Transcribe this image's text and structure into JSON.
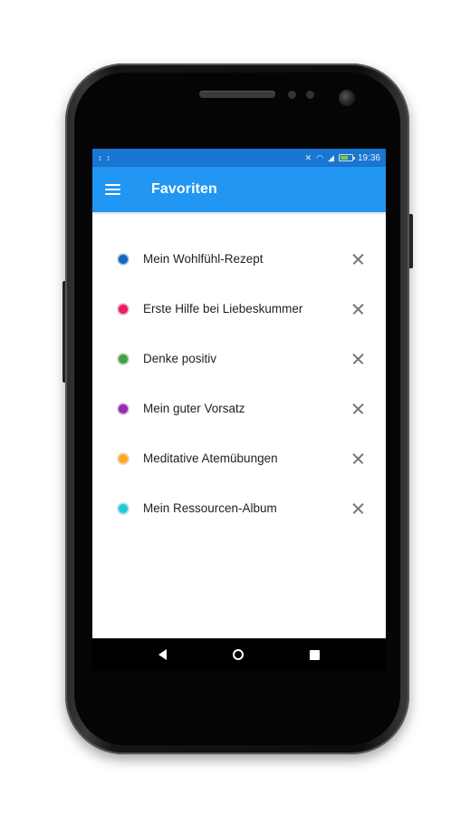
{
  "status_bar": {
    "left_icons": [
      "↕",
      "↕"
    ],
    "right_icons": [
      "mute-icon",
      "wifi-icon",
      "signal-icon",
      "battery-icon"
    ],
    "time": "19:36",
    "color": "#1976d2"
  },
  "app_bar": {
    "title": "Favoriten",
    "menu_icon": "hamburger-menu-icon",
    "color": "#2196f3"
  },
  "favorites": [
    {
      "label": "Mein Wohlfühl-Rezept",
      "color": "#1565c0"
    },
    {
      "label": "Erste Hilfe bei Liebeskummer",
      "color": "#e91e63"
    },
    {
      "label": "Denke positiv",
      "color": "#43a047"
    },
    {
      "label": "Mein guter Vorsatz",
      "color": "#9c27b0"
    },
    {
      "label": "Meditative Atemübungen",
      "color": "#ffa726"
    },
    {
      "label": "Mein Ressourcen-Album",
      "color": "#26c6da"
    }
  ],
  "nav_bar": {
    "buttons": [
      "back-icon",
      "home-icon",
      "recent-apps-icon"
    ]
  }
}
